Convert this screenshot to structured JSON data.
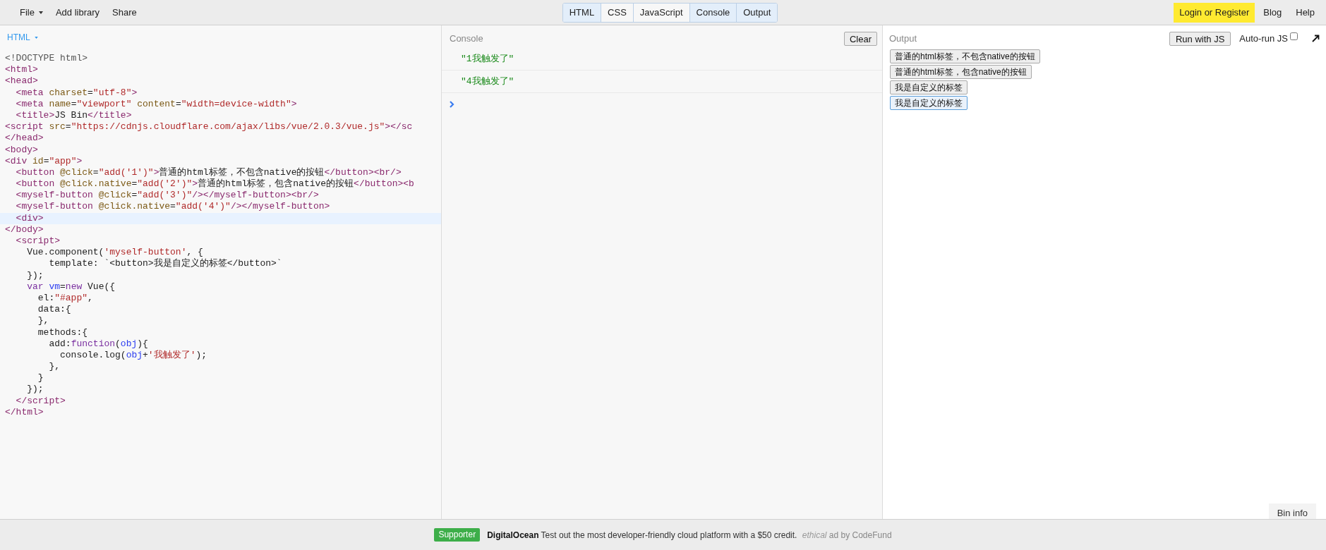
{
  "menu": {
    "left": [
      {
        "label": "File",
        "dropdown": true
      },
      {
        "label": "Add library",
        "dropdown": false
      },
      {
        "label": "Share",
        "dropdown": false
      }
    ],
    "tabs": [
      {
        "label": "HTML",
        "selected": true
      },
      {
        "label": "CSS",
        "selected": false
      },
      {
        "label": "JavaScript",
        "selected": false
      },
      {
        "label": "Console",
        "selected": true
      },
      {
        "label": "Output",
        "selected": true
      }
    ],
    "right": [
      {
        "label": "Login or Register",
        "highlighted": true
      },
      {
        "label": "Blog",
        "highlighted": false
      },
      {
        "label": "Help",
        "highlighted": false
      }
    ]
  },
  "editor": {
    "language": "HTML",
    "lines": [
      {
        "active": false,
        "tokens": [
          {
            "kind": "meta",
            "text": "<!DOCTYPE html>"
          }
        ]
      },
      {
        "active": false,
        "tokens": [
          {
            "kind": "tag",
            "text": "<html>"
          }
        ]
      },
      {
        "active": false,
        "tokens": [
          {
            "kind": "tag",
            "text": "<head>"
          }
        ]
      },
      {
        "active": false,
        "tokens": [
          {
            "kind": "tag",
            "text": "  <meta"
          },
          {
            "kind": "attr",
            "text": " charset"
          },
          {
            "kind": "plain",
            "text": "="
          },
          {
            "kind": "string",
            "text": "\"utf-8\""
          },
          {
            "kind": "tag",
            "text": ">"
          }
        ]
      },
      {
        "active": false,
        "tokens": [
          {
            "kind": "tag",
            "text": "  <meta"
          },
          {
            "kind": "attr",
            "text": " name"
          },
          {
            "kind": "plain",
            "text": "="
          },
          {
            "kind": "string",
            "text": "\"viewport\""
          },
          {
            "kind": "attr",
            "text": " content"
          },
          {
            "kind": "plain",
            "text": "="
          },
          {
            "kind": "string",
            "text": "\"width=device-width\""
          },
          {
            "kind": "tag",
            "text": ">"
          }
        ]
      },
      {
        "active": false,
        "tokens": [
          {
            "kind": "tag",
            "text": "  <title>"
          },
          {
            "kind": "plain",
            "text": "JS Bin"
          },
          {
            "kind": "tag",
            "text": "</title>"
          }
        ]
      },
      {
        "active": false,
        "tokens": [
          {
            "kind": "tag",
            "text": "<script"
          },
          {
            "kind": "attr",
            "text": " src"
          },
          {
            "kind": "plain",
            "text": "="
          },
          {
            "kind": "string",
            "text": "\"https://cdnjs.cloudflare.com/ajax/libs/vue/2.0.3/vue.js\""
          },
          {
            "kind": "tag",
            "text": "></sc"
          }
        ]
      },
      {
        "active": false,
        "tokens": [
          {
            "kind": "tag",
            "text": "</head>"
          }
        ]
      },
      {
        "active": false,
        "tokens": [
          {
            "kind": "tag",
            "text": "<body>"
          }
        ]
      },
      {
        "active": false,
        "tokens": [
          {
            "kind": "tag",
            "text": "<div"
          },
          {
            "kind": "attr",
            "text": " id"
          },
          {
            "kind": "plain",
            "text": "="
          },
          {
            "kind": "string",
            "text": "\"app\""
          },
          {
            "kind": "tag",
            "text": ">"
          }
        ]
      },
      {
        "active": false,
        "tokens": [
          {
            "kind": "tag",
            "text": "  <button"
          },
          {
            "kind": "attr",
            "text": " @click"
          },
          {
            "kind": "plain",
            "text": "="
          },
          {
            "kind": "string",
            "text": "\"add('1')\""
          },
          {
            "kind": "tag",
            "text": ">"
          },
          {
            "kind": "plain",
            "text": "普通的html标签，不包含native的按钮"
          },
          {
            "kind": "tag",
            "text": "</button><br/>"
          }
        ]
      },
      {
        "active": false,
        "tokens": [
          {
            "kind": "tag",
            "text": "  <button"
          },
          {
            "kind": "attr",
            "text": " @click.native"
          },
          {
            "kind": "plain",
            "text": "="
          },
          {
            "kind": "string",
            "text": "\"add('2')\""
          },
          {
            "kind": "tag",
            "text": ">"
          },
          {
            "kind": "plain",
            "text": "普通的html标签，包含native的按钮"
          },
          {
            "kind": "tag",
            "text": "</button><b"
          }
        ]
      },
      {
        "active": false,
        "tokens": [
          {
            "kind": "tag",
            "text": "  <myself-button"
          },
          {
            "kind": "attr",
            "text": " @click"
          },
          {
            "kind": "plain",
            "text": "="
          },
          {
            "kind": "string",
            "text": "\"add('3')\""
          },
          {
            "kind": "tag",
            "text": "/></myself-button><br/>"
          }
        ]
      },
      {
        "active": false,
        "tokens": [
          {
            "kind": "tag",
            "text": "  <myself-button"
          },
          {
            "kind": "attr",
            "text": " @click.native"
          },
          {
            "kind": "plain",
            "text": "="
          },
          {
            "kind": "string",
            "text": "\"add('4')\""
          },
          {
            "kind": "tag",
            "text": "/></myself-button>"
          }
        ]
      },
      {
        "active": true,
        "tokens": [
          {
            "kind": "tag",
            "text": "  <div>"
          }
        ]
      },
      {
        "active": false,
        "tokens": [
          {
            "kind": "tag",
            "text": "</body>"
          }
        ]
      },
      {
        "active": false,
        "tokens": [
          {
            "kind": "tag",
            "text": "  <script>"
          }
        ]
      },
      {
        "active": false,
        "tokens": [
          {
            "kind": "plain",
            "text": "    Vue.component("
          },
          {
            "kind": "string",
            "text": "'myself-button'"
          },
          {
            "kind": "plain",
            "text": ", {"
          }
        ]
      },
      {
        "active": false,
        "tokens": [
          {
            "kind": "plain",
            "text": "        template: `<button>我是自定义的标签</button>`"
          }
        ]
      },
      {
        "active": false,
        "tokens": [
          {
            "kind": "plain",
            "text": "    });"
          }
        ]
      },
      {
        "active": false,
        "tokens": [
          {
            "kind": "keyword",
            "text": "    var"
          },
          {
            "kind": "def",
            "text": " vm"
          },
          {
            "kind": "plain",
            "text": "="
          },
          {
            "kind": "keyword",
            "text": "new"
          },
          {
            "kind": "plain",
            "text": " Vue({"
          }
        ]
      },
      {
        "active": false,
        "tokens": [
          {
            "kind": "plain",
            "text": "      el:"
          },
          {
            "kind": "string",
            "text": "\"#app\""
          },
          {
            "kind": "plain",
            "text": ","
          }
        ]
      },
      {
        "active": false,
        "tokens": [
          {
            "kind": "plain",
            "text": "      data:{"
          }
        ]
      },
      {
        "active": false,
        "tokens": [
          {
            "kind": "plain",
            "text": "      },"
          }
        ]
      },
      {
        "active": false,
        "tokens": [
          {
            "kind": "plain",
            "text": "      methods:{"
          }
        ]
      },
      {
        "active": false,
        "tokens": [
          {
            "kind": "plain",
            "text": "        add:"
          },
          {
            "kind": "keyword",
            "text": "function"
          },
          {
            "kind": "plain",
            "text": "("
          },
          {
            "kind": "def",
            "text": "obj"
          },
          {
            "kind": "plain",
            "text": "){"
          }
        ]
      },
      {
        "active": false,
        "tokens": [
          {
            "kind": "plain",
            "text": "          console.log("
          },
          {
            "kind": "def",
            "text": "obj"
          },
          {
            "kind": "plain",
            "text": "+"
          },
          {
            "kind": "string",
            "text": "'我触发了'"
          },
          {
            "kind": "plain",
            "text": ");"
          }
        ]
      },
      {
        "active": false,
        "tokens": [
          {
            "kind": "plain",
            "text": "        },"
          }
        ]
      },
      {
        "active": false,
        "tokens": [
          {
            "kind": "plain",
            "text": "      }"
          }
        ]
      },
      {
        "active": false,
        "tokens": [
          {
            "kind": "plain",
            "text": "    });"
          }
        ]
      },
      {
        "active": false,
        "tokens": [
          {
            "kind": "tag",
            "text": "  </script>"
          }
        ]
      },
      {
        "active": false,
        "tokens": [
          {
            "kind": "tag",
            "text": "</html>"
          }
        ]
      }
    ]
  },
  "console": {
    "title": "Console",
    "clear_button": "Clear",
    "logs": [
      "\"1我触发了\"",
      "\"4我触发了\""
    ]
  },
  "output": {
    "title": "Output",
    "run_button": "Run with JS",
    "autorun": {
      "label": "Auto-run JS",
      "checked": false
    },
    "buttons": [
      {
        "label": "普通的html标签，不包含native的按钮",
        "focused": false
      },
      {
        "label": "普通的html标签，包含native的按钮",
        "focused": false
      },
      {
        "label": "我是自定义的标签",
        "focused": false
      },
      {
        "label": "我是自定义的标签",
        "focused": true
      }
    ],
    "bin_info": "Bin info"
  },
  "ad": {
    "badge": "Supporter",
    "sponsor": "DigitalOcean",
    "text": "Test out the most developer-friendly cloud platform with a $50 credit.",
    "ethical": "ethical",
    "by": "ad by CodeFund"
  }
}
